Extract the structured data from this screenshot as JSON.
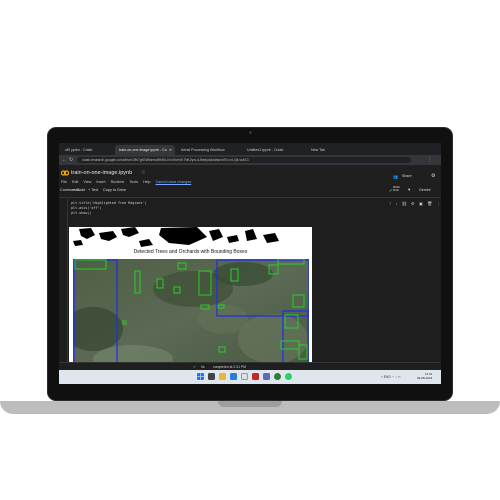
{
  "browser": {
    "tabs": [
      {
        "label": "uf5 yprkn - Colab",
        "active": false
      },
      {
        "label": "train-on-one-image.ipynb - Co",
        "active": true
      },
      {
        "label": "Aerial Processing Workflow",
        "active": false
      },
      {
        "label": "Untitled1.ipynb - Colab",
        "active": false
      },
      {
        "label": "New Tab",
        "active": false
      }
    ],
    "address": "colab.research.google.com/drive/1Rh7gKWBhmwWhEbJVxXKmVh7NK2yrs-6Jbsfyxs4sl#scrollTo=vt-QtLvsb13"
  },
  "colab": {
    "notebook_title": "train-on-one-image.ipynb",
    "menu": [
      "File",
      "Edit",
      "View",
      "Insert",
      "Runtime",
      "Tools",
      "Help"
    ],
    "changes_link": "Cannot save changes",
    "share_label": "Share",
    "toolbar": {
      "commands": "Commands",
      "add_code": "+ Code",
      "add_text": "+ Text",
      "copy_drive": "Copy to Drive",
      "ram": "RAM",
      "disk": "Disk",
      "gemini": "Gemini"
    }
  },
  "cell": {
    "code_lines": [
      "plt.title('Highlighted Tree Regions')",
      "plt.axis('off')",
      "plt.show()"
    ]
  },
  "figure": {
    "title": "Detected Trees and Orchards with Bounding Boxes",
    "box_colors": {
      "green": "#22d322",
      "blue": "#1d2cf0"
    }
  },
  "status": {
    "text": "completed at 2:31 PM"
  },
  "taskbar": {
    "time": "14:31",
    "date": "09-08-2024",
    "lang": "ENG"
  }
}
